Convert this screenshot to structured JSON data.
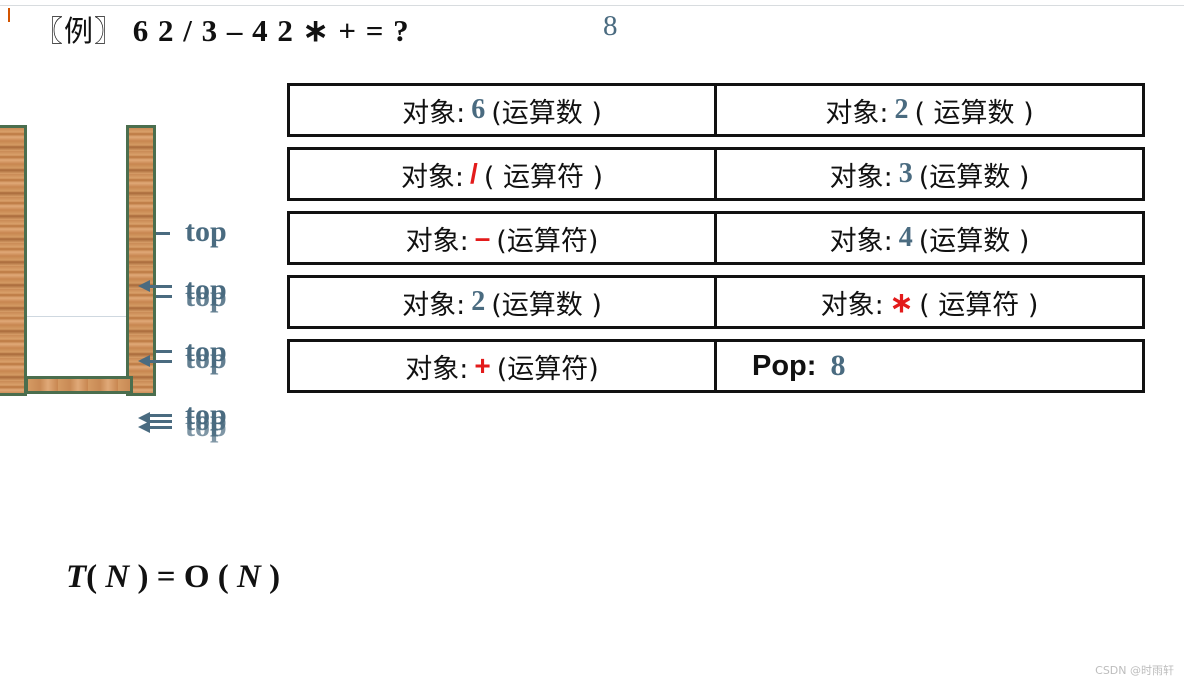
{
  "title": {
    "prefix": "〖例〗",
    "expression": "6 2 / 3 – 4 2 ∗ + = ?",
    "answer": "8"
  },
  "stack": {
    "pointer_label": "top"
  },
  "steps": [
    {
      "label": "对象:",
      "value": "6",
      "kind": "(运算数 )",
      "type": "operand"
    },
    {
      "label": "对象:",
      "value": "2",
      "kind": "( 运算数 )",
      "type": "operand"
    },
    {
      "label": "对象:",
      "value": "/",
      "kind": "( 运算符 )",
      "type": "operator"
    },
    {
      "label": "对象:",
      "value": "3",
      "kind": "(运算数 )",
      "type": "operand"
    },
    {
      "label": "对象:",
      "value": "–",
      "kind": "(运算符)",
      "type": "operator"
    },
    {
      "label": "对象:",
      "value": "4",
      "kind": "(运算数 )",
      "type": "operand"
    },
    {
      "label": "对象:",
      "value": "2",
      "kind": "(运算数 )",
      "type": "operand"
    },
    {
      "label": "对象:",
      "value": "∗",
      "kind": "( 运算符 )",
      "type": "operator"
    },
    {
      "label": "对象:",
      "value": "+",
      "kind": "(运算符)",
      "type": "operator"
    }
  ],
  "pop": {
    "label": "Pop:",
    "value": "8"
  },
  "formula": {
    "T": "T",
    "open1": "(",
    "N1": "N",
    "close1": ")",
    "eq": "=",
    "O": "O",
    "open2": "(",
    "N2": "N",
    "close2": ")"
  },
  "watermark": "CSDN @时雨轩",
  "colors": {
    "operand": "#4a6b80",
    "operator": "#e31b1b",
    "stack_border": "#4b6e4e"
  }
}
